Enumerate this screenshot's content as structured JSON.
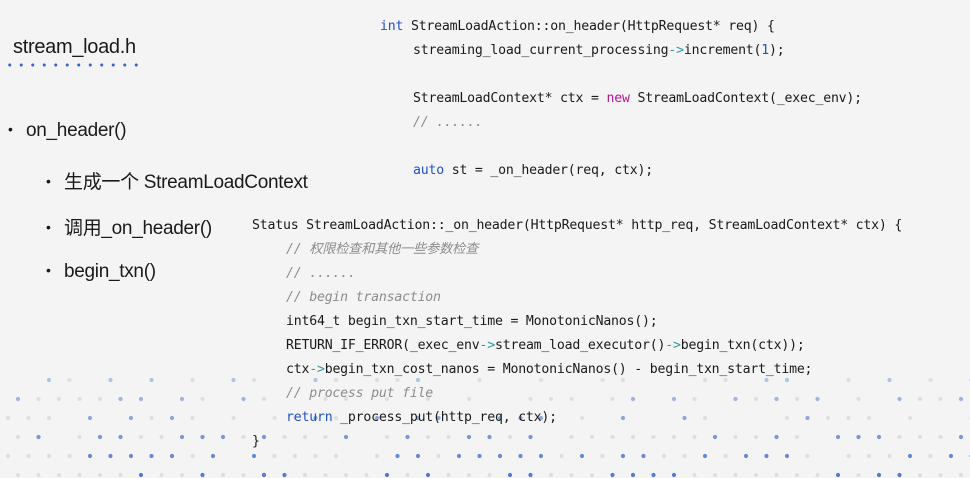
{
  "slide": {
    "title": "stream_load.h",
    "bullets": {
      "on_header": "on_header()",
      "create_context": "生成一个 StreamLoadContext",
      "call_on_header": "调用_on_header()",
      "begin_txn": "begin_txn()"
    }
  },
  "code_top": {
    "l1_kw": "int",
    "l1_rest": " StreamLoadAction::on_header(HttpRequest* req) {",
    "l2_a": "streaming_load_current_processing",
    "l2_arrow": "->",
    "l2_b": "increment(",
    "l2_num": "1",
    "l2_c": ");",
    "l3_a": "StreamLoadContext* ctx = ",
    "l3_new": "new",
    "l3_b": " StreamLoadContext(_exec_env);",
    "l4_comment": "// ......",
    "l5_kw": "auto",
    "l5_rest": " st = _on_header(req, ctx);"
  },
  "code_bottom": {
    "sig": "Status StreamLoadAction::_on_header(HttpRequest* http_req, StreamLoadContext* ctx) {",
    "c1": "// 权限检查和其他一些参数检查",
    "c2": "// ......",
    "c3": "// begin transaction",
    "s1": "int64_t begin_txn_start_time = MonotonicNanos();",
    "s2_a": "RETURN_IF_ERROR(_exec_env",
    "s2_arrow1": "->",
    "s2_b": "stream_load_executor()",
    "s2_arrow2": "->",
    "s2_c": "begin_txn(ctx));",
    "s3_a": "ctx",
    "s3_arrow": "->",
    "s3_b": "begin_txn_cost_nanos = MonotonicNanos() - begin_txn_start_time;",
    "c4": "// process put file",
    "ret_kw": "return",
    "ret_rest": " _process_put(http_req, ctx);",
    "close": "}"
  },
  "colors": {
    "background": "#f4f4f4",
    "keyword": "#2250c8",
    "new_keyword": "#b0178f",
    "arrow": "#2a9aa4",
    "comment": "#8c8c8c",
    "decor_dot_blue": "#3366cc"
  }
}
